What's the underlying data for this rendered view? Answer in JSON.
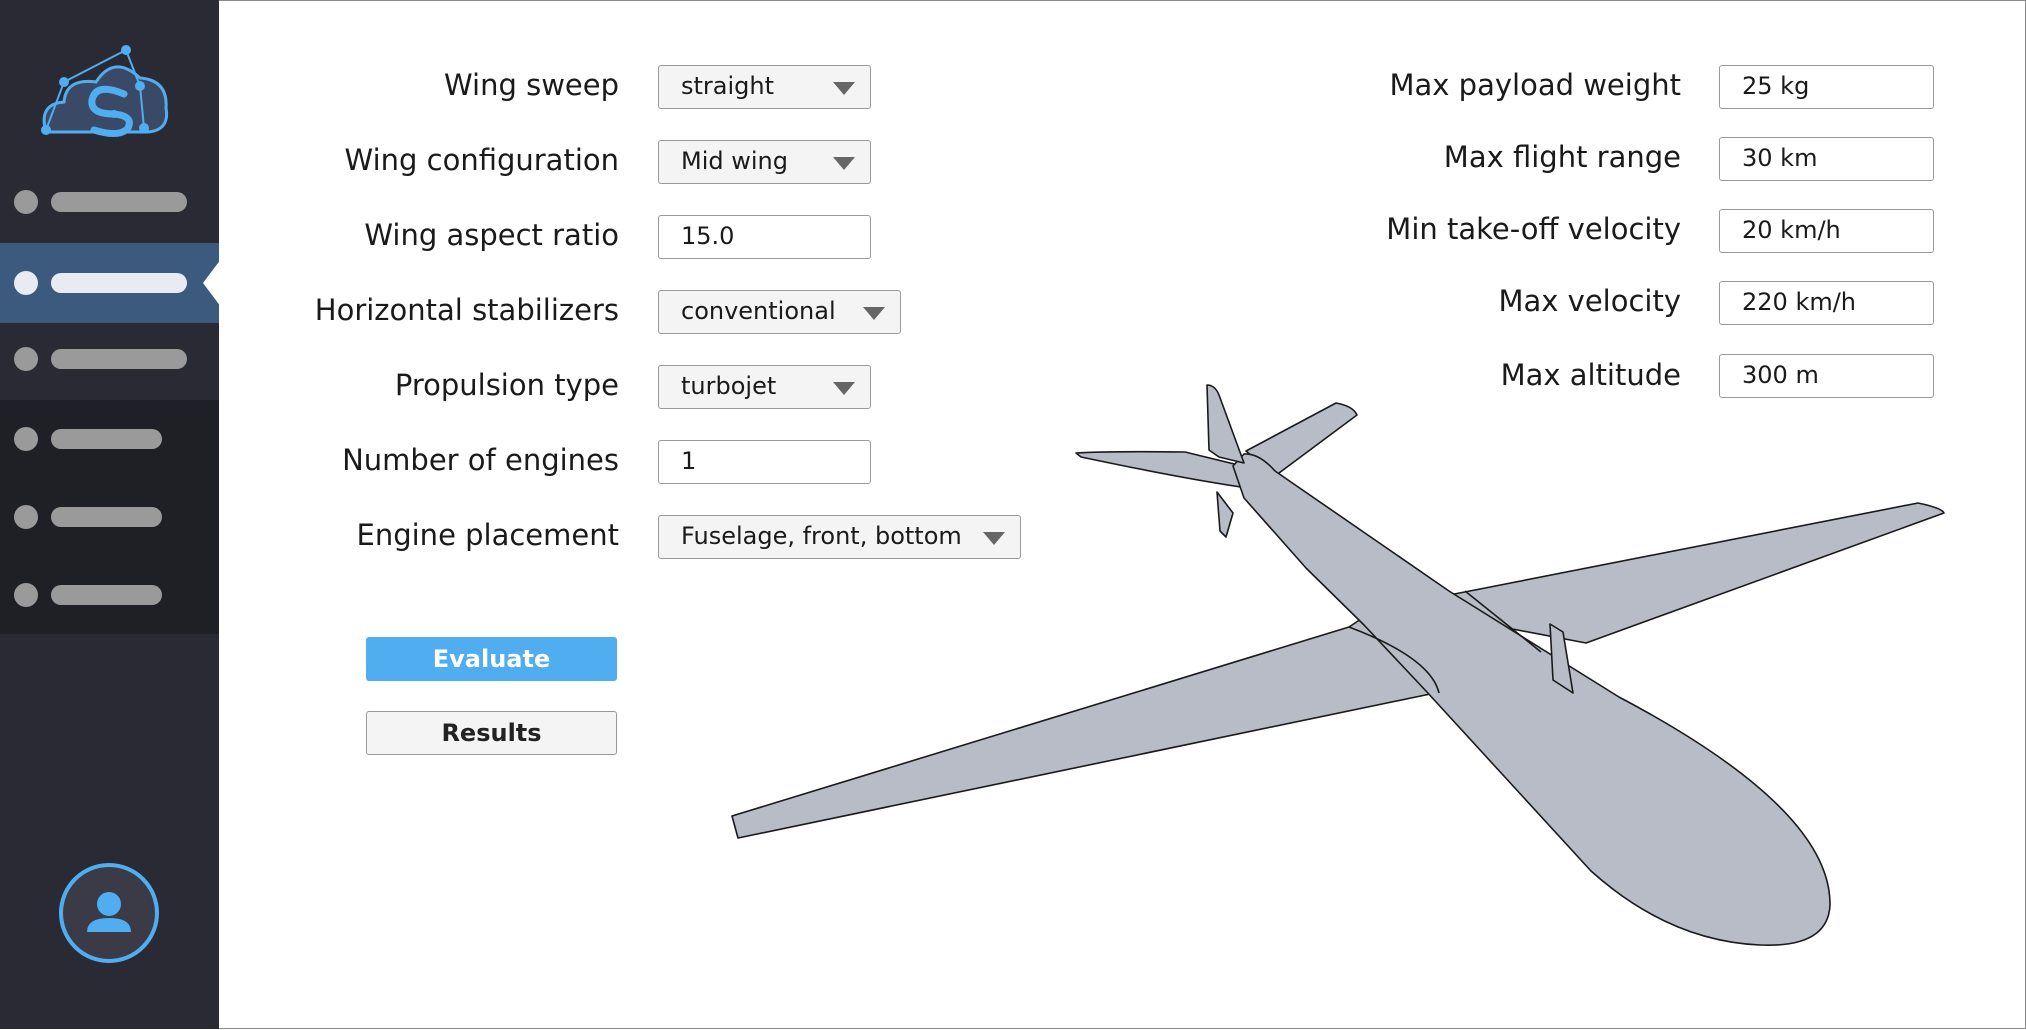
{
  "sidebar": {
    "logo_icon": "cloud-drone-logo",
    "avatar_icon": "user-icon"
  },
  "form_left": {
    "wing_sweep": {
      "label": "Wing sweep",
      "value": "straight"
    },
    "wing_configuration": {
      "label": "Wing configuration",
      "value": "Mid wing"
    },
    "wing_aspect_ratio": {
      "label": "Wing aspect ratio",
      "value": "15.0"
    },
    "horizontal_stabilizers": {
      "label": "Horizontal stabilizers",
      "value": "conventional"
    },
    "propulsion_type": {
      "label": "Propulsion type",
      "value": "turbojet"
    },
    "number_of_engines": {
      "label": "Number of engines",
      "value": "1"
    },
    "engine_placement": {
      "label": "Engine placement",
      "value": "Fuselage, front, bottom"
    }
  },
  "form_right": {
    "max_payload_weight": {
      "label": "Max payload weight",
      "value": "25 kg"
    },
    "max_flight_range": {
      "label": "Max flight range",
      "value": "30 km"
    },
    "min_takeoff_velocity": {
      "label": "Min take-off velocity",
      "value": "20 km/h"
    },
    "max_velocity": {
      "label": "Max velocity",
      "value": "220 km/h"
    },
    "max_altitude": {
      "label": "Max altitude",
      "value": "300 m"
    }
  },
  "actions": {
    "evaluate": "Evaluate",
    "results": "Results"
  },
  "colors": {
    "sidebar_bg": "#2a2a35",
    "sidebar_active": "#3c5a7e",
    "accent": "#4fadf0",
    "aircraft_fill": "#b7bcc7"
  }
}
